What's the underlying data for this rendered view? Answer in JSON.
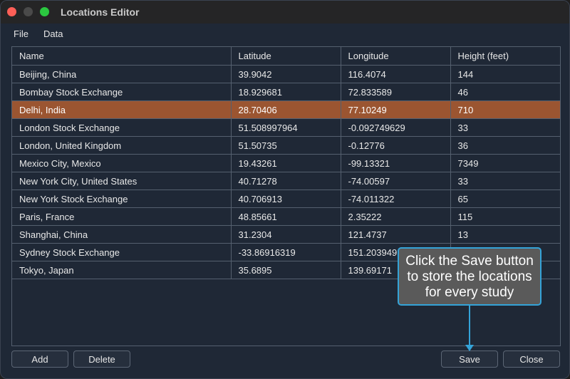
{
  "window": {
    "title": "Locations Editor"
  },
  "menu": [
    "File",
    "Data"
  ],
  "table": {
    "columns": [
      "Name",
      "Latitude",
      "Longitude",
      "Height (feet)"
    ],
    "selected_row": 2,
    "rows": [
      [
        "Beijing, China",
        "39.9042",
        "116.4074",
        "144"
      ],
      [
        "Bombay Stock Exchange",
        "18.929681",
        "72.833589",
        "46"
      ],
      [
        "Delhi, India",
        "28.70406",
        "77.10249",
        "710"
      ],
      [
        "London Stock Exchange",
        "51.508997964",
        "-0.092749629",
        "33"
      ],
      [
        "London, United Kingdom",
        "51.50735",
        "-0.12776",
        "36"
      ],
      [
        "Mexico City, Mexico",
        "19.43261",
        "-99.13321",
        "7349"
      ],
      [
        "New York City, United States",
        "40.71278",
        "-74.00597",
        "33"
      ],
      [
        "New York Stock Exchange",
        "40.706913",
        "-74.011322",
        "65"
      ],
      [
        "Paris, France",
        "48.85661",
        "2.35222",
        "115"
      ],
      [
        "Shanghai, China",
        "31.2304",
        "121.4737",
        "13"
      ],
      [
        "Sydney Stock Exchange",
        "-33.86916319",
        "151.2039491",
        ""
      ],
      [
        "Tokyo, Japan",
        "35.6895",
        "139.69171",
        ""
      ]
    ]
  },
  "buttons": {
    "add": "Add",
    "delete": "Delete",
    "save": "Save",
    "close": "Close"
  },
  "tooltip": {
    "lines": [
      "Click the Save button",
      "to store the locations",
      "for every study"
    ]
  },
  "colors": {
    "selection": "#9b5531",
    "callout_border": "#34a3d8"
  }
}
